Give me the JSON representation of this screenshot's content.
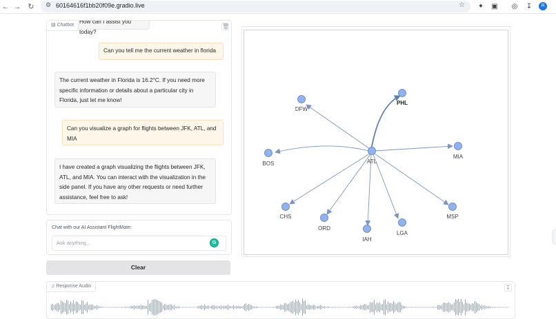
{
  "browser": {
    "url": "60164616f1bb20f09e.gradio.live",
    "profile_initial": "R",
    "icons": [
      "back-icon",
      "forward-icon",
      "reload-icon",
      "site-info-icon",
      "bookmark-star-icon",
      "sparkle-icon",
      "extensions-icon",
      "media-icon",
      "download-icon"
    ]
  },
  "chatbot": {
    "label": "Chatbot",
    "messages": [
      {
        "role": "bot",
        "text": "How can I assist you today?"
      },
      {
        "role": "user",
        "text": "Can you tell me the current weather in florida"
      },
      {
        "role": "bot",
        "text": "The current weather in Florida is 16.2°C. If you need more specific information or details about a particular city in Florida, just let me know!"
      },
      {
        "role": "user",
        "text": "Can you visualize a graph for flights between JFK, ATL, and MIA"
      },
      {
        "role": "bot",
        "text": "I have created a graph visualizing the flights between JFK, ATL, and MIA. You can interact with the visualization in the side panel. If you have any other requests or need further assistance, feel free to ask!"
      }
    ]
  },
  "input": {
    "label": "Chat with our AI Assistant FlightMate:",
    "placeholder": "Ask anything...",
    "grammarly": "G"
  },
  "clear_label": "Clear",
  "graph": {
    "hub": "ATL",
    "highlighted": "PHL",
    "nodes": [
      "ATL",
      "PHL",
      "DFW",
      "BOS",
      "MIA",
      "CHS",
      "ORD",
      "IAH",
      "LGA",
      "MSP"
    ],
    "node_color": "#8fb3f0",
    "edge_color": "#7b96c4",
    "highlight_edge_color": "#5a7fb8"
  },
  "audio": {
    "label": "Response Audio",
    "waveform_color": "#9ca3af"
  }
}
